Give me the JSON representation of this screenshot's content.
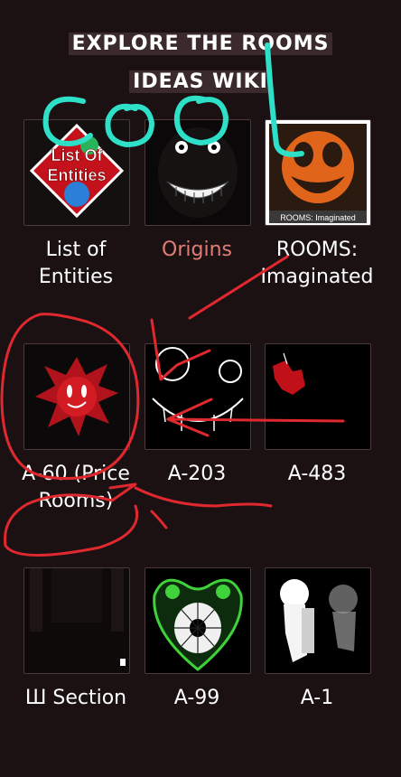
{
  "wiki": {
    "title_line1": "EXPLORE THE ROOMS",
    "title_line2": "IDEAS WIKI"
  },
  "tiles": [
    {
      "label": "List of Entities",
      "thumb_text_1": "List Of",
      "thumb_text_2": "Entities"
    },
    {
      "label": "Origins",
      "style": "link"
    },
    {
      "label": "ROOMS: Imaginated",
      "thumb_caption": "ROOMS: Imaginated"
    },
    {
      "label": "A-60 (Price Rooms)"
    },
    {
      "label": "A-203"
    },
    {
      "label": "A-483"
    },
    {
      "label": "Ш Section"
    },
    {
      "label": "A-99"
    },
    {
      "label": "A-1"
    }
  ],
  "annotations": {
    "scribble_text": "cool",
    "scribble_color": "#2ee0c8",
    "pen_color": "#e0282f"
  }
}
